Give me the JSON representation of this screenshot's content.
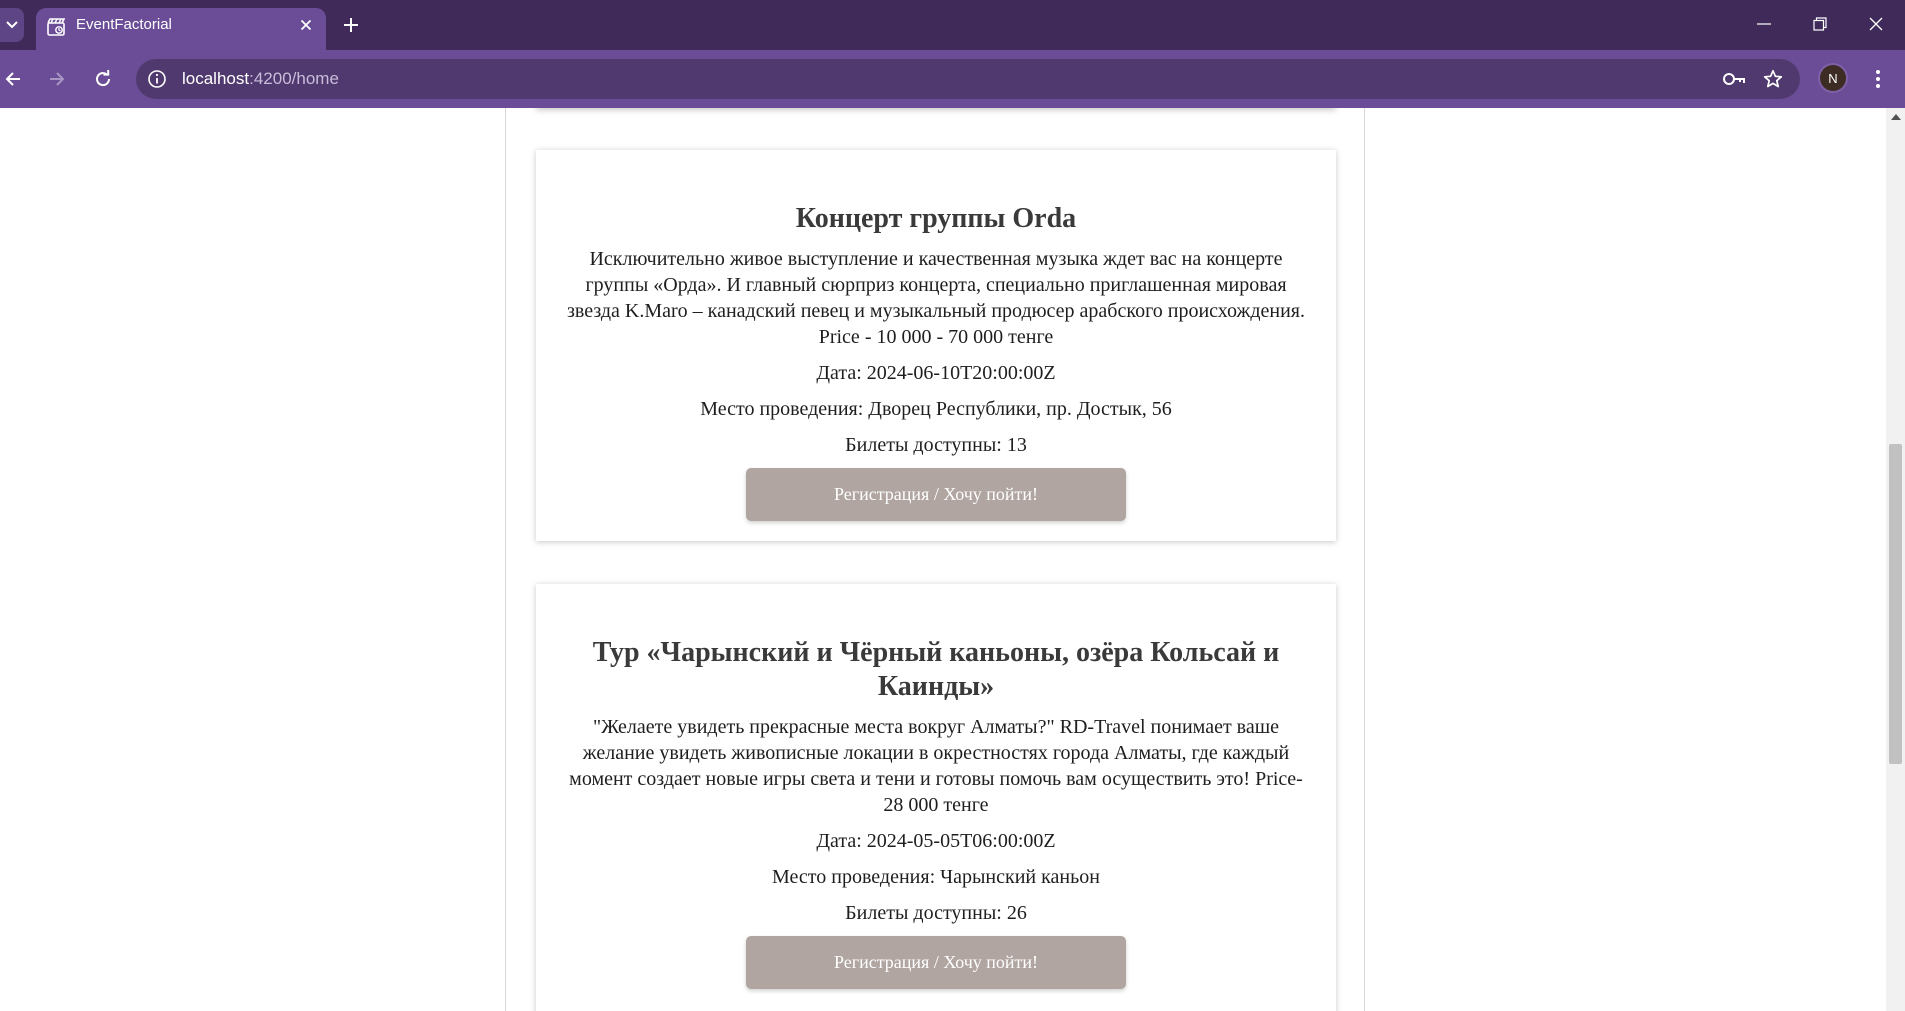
{
  "browser": {
    "tab": {
      "title": "EventFactorial",
      "favicon": "clapperboard-icon"
    },
    "address": {
      "host": "localhost",
      "path": ":4200/home"
    },
    "profile_initial": "N",
    "icons": {
      "tab_search": "chevron-down-icon",
      "close_tab": "close-icon",
      "new_tab": "plus-icon",
      "back": "arrow-left-icon",
      "forward": "arrow-right-icon",
      "reload": "reload-icon",
      "site_info": "info-icon",
      "passwords": "key-icon",
      "bookmark": "star-icon",
      "menu": "kebab-menu-icon",
      "minimize": "minimize-icon",
      "restore": "restore-icon",
      "close_window": "close-icon"
    },
    "colors": {
      "tab_strip": "#3f2a5a",
      "toolbar": "#6a4d96",
      "omnibox": "#50396e"
    }
  },
  "events": [
    {
      "title": "Концерт группы Orda",
      "description": "Исключительно живое выступление и качественная музыка ждет вас на концерте группы «Орда». И главный сюрприз концерта, специально приглашенная мировая звезда K.Maro – канадский певец и музыкальный продюсер арабского происхождения. Price - 10 000 - 70 000 тенге",
      "date": "Дата: 2024-06-10T20:00:00Z",
      "venue": "Место проведения: Дворец Республики, пр. Достык, 56",
      "tickets": "Билеты доступны: 13",
      "button_label": "Регистрация / Хочу пойти!"
    },
    {
      "title": "Тур «Чарынский и Чёрный каньоны, озёра Кольсай и Каинды»",
      "description": "\"Желаете увидеть прекрасные места вокруг Алматы?\" RD-Travel понимает ваше желание увидеть живописные локации в окрестностях города Алматы, где каждый момент создает новые игры света и тени и готовы помочь вам осуществить это! Price-28 000 тенге",
      "date": "Дата: 2024-05-05T06:00:00Z",
      "venue": "Место проведения: Чарынский каньон",
      "tickets": "Билеты доступны: 26",
      "button_label": "Регистрация / Хочу пойти!"
    }
  ],
  "theme": {
    "button_color": "#b0a5a1",
    "title_color": "#3a3a3a"
  }
}
